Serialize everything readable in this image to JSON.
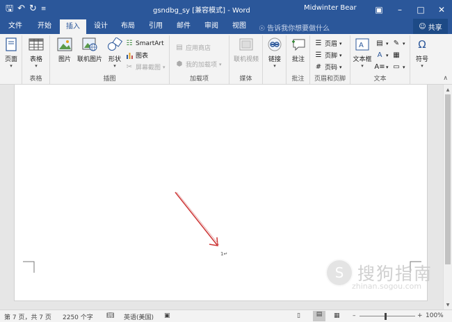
{
  "titlebar": {
    "doc_title": "gsndbg_sy [兼容模式] - Word",
    "user": "Midwinter Bear",
    "save_icon": "save-icon",
    "undo_icon": "undo-icon",
    "redo_icon": "redo-icon",
    "customize_icon": "customize-qat-icon"
  },
  "tabs": [
    {
      "label": "文件"
    },
    {
      "label": "开始"
    },
    {
      "label": "插入"
    },
    {
      "label": "设计"
    },
    {
      "label": "布局"
    },
    {
      "label": "引用"
    },
    {
      "label": "邮件"
    },
    {
      "label": "审阅"
    },
    {
      "label": "视图"
    }
  ],
  "active_tab": "插入",
  "tell_me": "告诉我你想要做什么",
  "share": "共享",
  "ribbon": {
    "pages": {
      "btn": "页面",
      "group": ""
    },
    "tables": {
      "btn": "表格",
      "group": "表格"
    },
    "illustrations": {
      "group": "插图",
      "picture": "图片",
      "online_picture": "联机图片",
      "shapes": "形状",
      "smartart": "SmartArt",
      "chart": "图表",
      "screenshot": "屏幕截图"
    },
    "addins": {
      "group": "加载项",
      "store": "应用商店",
      "my_addins": "我的加载项"
    },
    "media": {
      "group": "媒体",
      "online_video": "联机视频"
    },
    "links": {
      "btn": "链接"
    },
    "comments": {
      "group": "批注",
      "btn": "批注"
    },
    "header_footer": {
      "group": "页眉和页脚",
      "header": "页眉",
      "footer": "页脚",
      "page_number": "页码"
    },
    "text": {
      "group": "文本",
      "textbox": "文本框"
    },
    "symbols": {
      "btn": "符号",
      "icon_char": "Ω"
    }
  },
  "document": {
    "page_number_text": "1↵"
  },
  "status": {
    "page": "第 7 页，共 7 页",
    "words": "2250 个字",
    "language": "英语(美国)",
    "zoom": "100%"
  },
  "watermark": {
    "text": "搜狗指南",
    "url": "zhinan.sogou.com"
  },
  "colors": {
    "accent": "#2b579a",
    "arrow": "#cc3333"
  }
}
